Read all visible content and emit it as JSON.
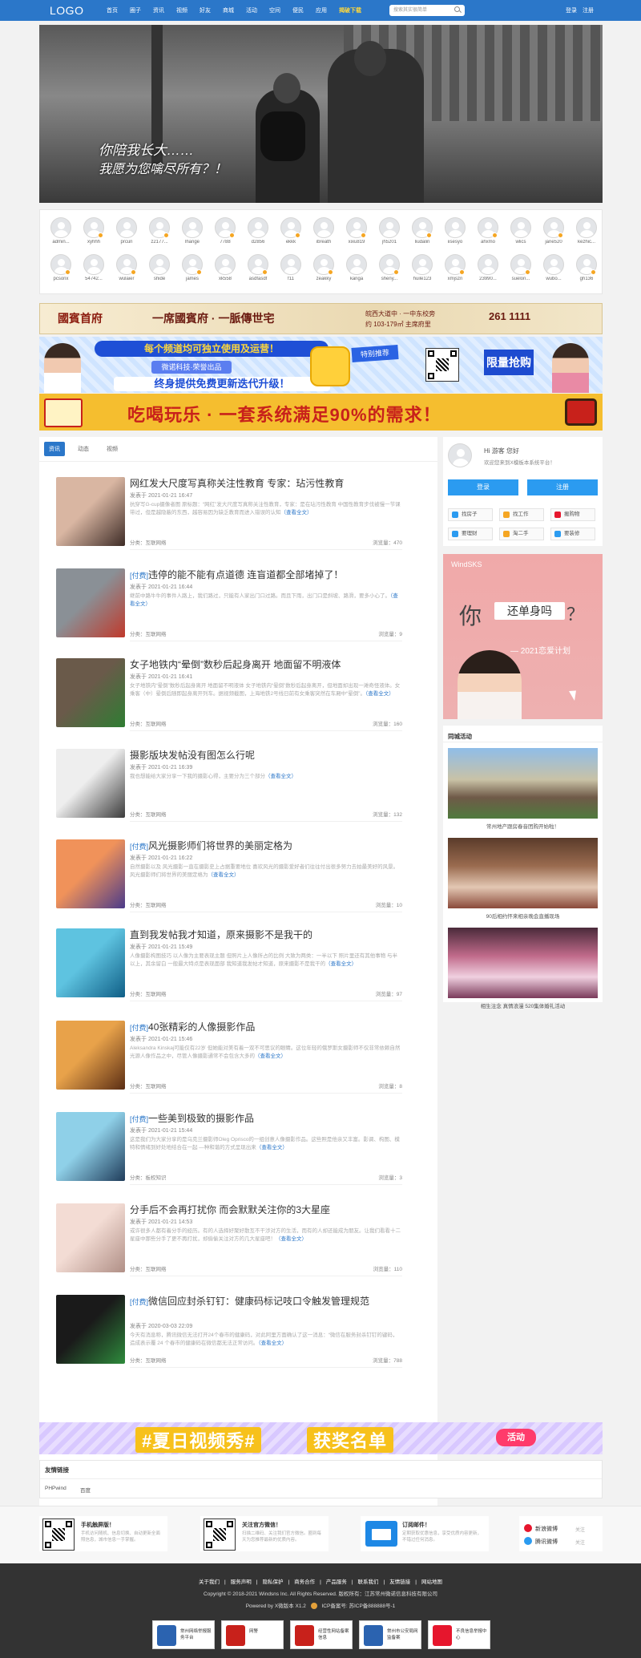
{
  "header": {
    "logo": "LOGO",
    "nav": [
      "首页",
      "圈子",
      "资讯",
      "视频",
      "好友",
      "商城",
      "活动",
      "空间",
      "便民",
      "应用",
      "揭破下载"
    ],
    "search_placeholder": "搜索其实很简单",
    "login": "登录",
    "register": "注册"
  },
  "hero": {
    "line1": "你陪我长大……",
    "line2": "我愿为您噙尽所有？！"
  },
  "users": {
    "row1": [
      "admin...",
      "xyhhh",
      "prcun",
      "z2177...",
      "lhange",
      "7788",
      "d2856",
      "ekkk",
      "ibreath",
      "xixu819",
      "jh5201",
      "liudalin",
      "iisesyo",
      "ahxmo",
      "wlics",
      "jane520",
      "kezhic..."
    ],
    "row2": [
      "pcsonx",
      "54742...",
      "wulaier",
      "shide",
      "james",
      "xk558",
      "asdfasdf",
      "f11",
      "zeakky",
      "kanga",
      "sheny...",
      "huile123",
      "xmjszn",
      "23990...",
      "suelon...",
      "wubo...",
      "gh136"
    ]
  },
  "ads": {
    "ad1_left": "國賓首府",
    "ad1_slogan": "一席國賓府 · 一脈傳世宅",
    "ad1_addr": "皖西大道中 · 一中东校旁",
    "ad1_size": "约 103-179㎡ 主席府里",
    "ad1_phone": "261 1111",
    "ad2_pill": "每个频道均可独立使用及运营！",
    "ad2_sub": "微诺科技·荣誉出品",
    "ad2_main": "终身提供免费更新迭代升级！",
    "ad2_tag1": "特别推荐",
    "ad2_tag2": "限量抢购",
    "ad3_text": "吃喝玩乐 · 一套系统满足90%的需求！",
    "ad4_brand": "WindSKS",
    "ad4_ni": "你",
    "ad4_box": "还单身吗",
    "ad4_q": "？",
    "ad4_year": "— 2021恋爱计划",
    "ad5_t1": "#夏日视频秀#",
    "ad5_t2": "获奖名单",
    "ad5_act": "活动"
  },
  "tabs": [
    "资讯",
    "动态",
    "视频"
  ],
  "posts": [
    {
      "paid": "",
      "title": "网红发大尺度写真称关注性教育 专家：玷污性教育",
      "author": "发表于",
      "date": "2021-01-21 16:47",
      "excerpt": "抗穿写G-cup摄像者图 原标题：“网红”发大尺度写真称关注性教育，专家：是在玷污性教育 中国性教育步伐被慢一节课带过，但是越隐蔽的东西，越容易因为缺乏教育而进入错误的认知",
      "more": "（查看全文）",
      "cat": "分类：互联网络",
      "views": "浏览量：470",
      "img1": "#d9b6a2",
      "img2": "#3d2b26"
    },
    {
      "paid": "[付费]",
      "title": "违停的能不能有点道德 连盲道都全部堵掉了！",
      "author": "发表于",
      "date": "2021-01-21 16:44",
      "excerpt": "继前中路牛牛的事件人路上，我们路过，只能有人家出门口过路。而且下雨，出门口是斜坡、路滑，要多小心了。",
      "more": "（查看全文）",
      "cat": "分类：互联网络",
      "views": "浏览量：9",
      "img1": "#8a9096",
      "img2": "#c0392b"
    },
    {
      "paid": "",
      "title": "女子地铁内“晕倒”数秒后起身离开 地面留不明液体",
      "author": "发表于",
      "date": "2021-01-21 16:41",
      "excerpt": "女子地铁内“晕倒”数秒后起身离开 地面留不明液体 女子地铁内“晕倒”数秒后起身离开，但地面却出现一滩奇怪液体。女乘客（中）晕倒后随即起身离开列车。据视频截图，上海地铁2号线日前有女乘客突然在车厢中“晕倒”。",
      "more": "（查看全文）",
      "cat": "分类：互联网络",
      "views": "浏览量：160",
      "img1": "#6a5a4a",
      "img2": "#2e7d32"
    },
    {
      "paid": "",
      "title": "摄影版块发帖没有图怎么行呢",
      "author": "发表于",
      "date": "2021-01-21 16:39",
      "excerpt": "我也想能给大家分享一下我的摄影心得，主要分为三个部分",
      "more": "（查看全文）",
      "cat": "分类：互联网络",
      "views": "浏览量：132",
      "img1": "#eeeeee",
      "img2": "#3b3b3b"
    },
    {
      "paid": "[付费]",
      "title": "风光摄影师们将世界的美丽定格为",
      "author": "发表于",
      "date": "2021-01-21 16:22",
      "excerpt": "自然摄影以及 风光摄影一直在摄影史上占据重要地位 喜欢风光的摄影爱好者们往往付出很多努力去拍最美好的风景。风光摄影师们将世界的美丽定格为",
      "more": "（查看全文）",
      "cat": "分类：互联网络",
      "views": "浏览量：10",
      "img1": "#f0925a",
      "img2": "#4a3a8a"
    },
    {
      "paid": "",
      "title": "直到我发帖我才知道，原来摄影不是我干的",
      "author": "发表于",
      "date": "2021-01-21 15:49",
      "excerpt": "人像摄影构图技巧 以人像为主要表现主题 但照片上人像所占的比例 大致为两类：一半以下 照片里还有其他事物 与半以上，其余留白 一般最大特点是表现面部 我知道我发帖才知道，原来摄影不是我干的",
      "more": "（查看全文）",
      "cat": "分类：互联网络",
      "views": "浏览量：97",
      "img1": "#5ec3e0",
      "img2": "#0f5e86"
    },
    {
      "paid": "[付费]",
      "title": "40张精彩的人像摄影作品",
      "author": "发表于",
      "date": "2021-01-21 15:46",
      "excerpt": "Aleksandra Kinskaj可能仅有22岁 但她能对美有着一双不可思议的眼睛。这位年轻的俄罗斯女摄影师不仅非常依赖自然光源人像作品之中，尽管人像摄影通常不会包含大多的",
      "more": "（查看全文）",
      "cat": "分类：互联网络",
      "views": "浏览量：8",
      "img1": "#e8a24a",
      "img2": "#5a2d14"
    },
    {
      "paid": "[付费]",
      "title": "一些美到极致的摄影作品",
      "author": "发表于",
      "date": "2021-01-21 15:44",
      "excerpt": "这是我们为大家分享的是乌克兰摄影师Oleg Oprisco的一组创意人像摄影作品。这些照是他亲又丰富。影调、构图、模特和情绪到好处地结合在一起 —种和谐的方式呈现出来",
      "more": "（查看全文）",
      "cat": "分类：板权知识",
      "views": "浏览量：3",
      "img1": "#8fd0e8",
      "img2": "#1f3c5a"
    },
    {
      "paid": "",
      "title": "分手后不会再打扰你 而会默默关注你的3大星座",
      "author": "发表于",
      "date": "2021-01-21 14:53",
      "excerpt": "或许很多人都有着分手的经历。有的人选择好聚好散互不干涉对方的生活，而有的人却还能成为朋友。让我们看看十二星座中那些分手了更不再打扰，却偷偷关注对方的几大星座吧！",
      "more": "（查看全文）",
      "cat": "分类：互联网络",
      "views": "浏览量：110",
      "img1": "#f3dcd4",
      "img2": "#b08f86"
    },
    {
      "paid": "[付费]",
      "title": "微信回应封杀钉钉：健康码标记吱口令触发管理规范",
      "author": "发表于",
      "date": "2020-03-03 22:09",
      "excerpt": "今天有消息称，腾讯微信无法打开24个春市的健康码，对此阿里方面确认了这一消息：“微信在服务封杀钉钉的键码，造成表示覆 24 个春市的健康码在微信都无法正常访问。",
      "more": "（查看全文）",
      "cat": "分类：互联网络",
      "views": "浏览量：788",
      "img1": "#1a1a1a",
      "img2": "#2e8b3c"
    }
  ],
  "sidebar": {
    "hi": "Hi 游客 您好",
    "welcome": "欢迎您来到X模板本系统平台！",
    "login": "登录",
    "register": "注册",
    "links": [
      "找房子",
      "找工作",
      "搬购物",
      "要理财",
      "淘二手",
      "要装修"
    ],
    "activity_title": "同城活动",
    "activities": [
      "常州地产跟房春音团购开始啦！",
      "90后相约怀来相亲晚会直播现场",
      "相生注念 真情浪漫 520集体婚礼活动"
    ]
  },
  "friendlinks": {
    "title": "友情链接",
    "items": [
      "PHPwind",
      "百度"
    ]
  },
  "footbar": [
    {
      "t1": "手机触屏版！",
      "t2": "手机访问随机、信息切换、自动更新全面照信息，城市信息一手掌握。"
    },
    {
      "t1": "关注官方微信！",
      "t2": "扫描二维码、关注我们官方微信。圈到每天为您推荐最新的优质内容。"
    },
    {
      "t1": "订阅邮件！",
      "t2": "定期获取优惠信息，享受优质内容更新，不错过任何消息。"
    }
  ],
  "weibo": [
    {
      "name": "新浪微博",
      "follow": "关注"
    },
    {
      "name": "腾讯微博",
      "follow": "关注"
    }
  ],
  "footer": {
    "links": [
      "关于我们",
      "服务声明",
      "隐私保护",
      "商务合作",
      "产品服务",
      "联系我们",
      "友情链接",
      "网站地图"
    ],
    "copyright": "Copyright © 2018-2021  Windsns Inc. All Rights Reserved. 版权所有：江苏常州微诺信息科技有限公司",
    "powered": "Powered by X微版本 X1.2",
    "icp": "ICP备案号: 苏ICP备888888号-1",
    "badges": [
      "常州网络举报服务平台",
      "网警",
      "经营性网站备案信息",
      "常州市公安局网监备案",
      "不良信息举报中心"
    ]
  },
  "colors": {
    "brand": "#2b77c9",
    "accent": "#2b9bf0",
    "highlight": "#ffd83b"
  }
}
